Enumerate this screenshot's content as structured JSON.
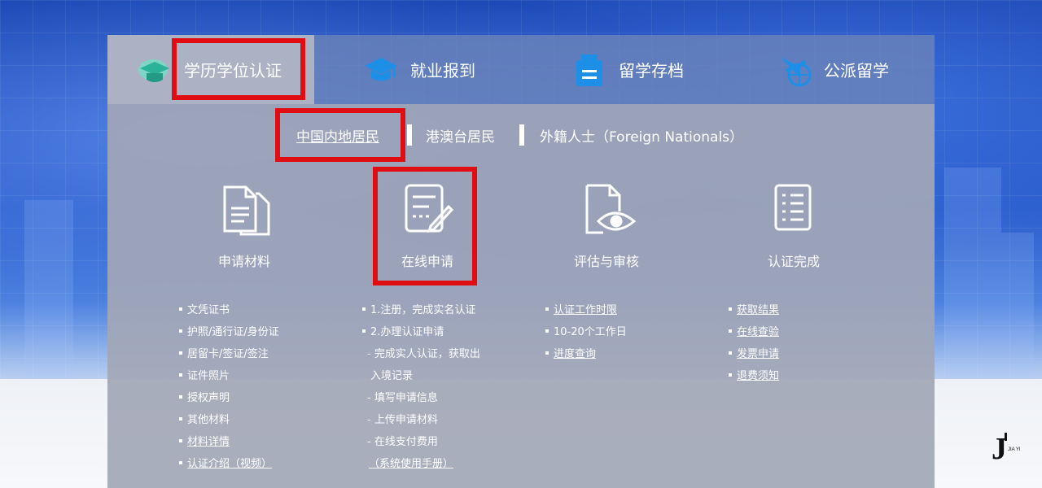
{
  "main_tabs": [
    {
      "label": "学历学位认证",
      "icon": "graduation-book-icon",
      "active": true
    },
    {
      "label": "就业报到",
      "icon": "mortarboard-icon"
    },
    {
      "label": "留学存档",
      "icon": "archive-card-icon"
    },
    {
      "label": "公派留学",
      "icon": "airplane-globe-icon"
    }
  ],
  "sub_tabs": [
    {
      "label": "中国内地居民",
      "active": true
    },
    {
      "label": "港澳台居民"
    },
    {
      "label": "外籍人士（Foreign Nationals）"
    }
  ],
  "steps": [
    {
      "label": "申请材料",
      "icon": "documents-icon"
    },
    {
      "label": "在线申请",
      "icon": "edit-form-icon"
    },
    {
      "label": "评估与审核",
      "icon": "document-eye-icon"
    },
    {
      "label": "认证完成",
      "icon": "checklist-icon"
    }
  ],
  "columns": [
    [
      {
        "text": "文凭证书",
        "bullet": true
      },
      {
        "text": "护照/通行证/身份证",
        "bullet": true
      },
      {
        "text": "居留卡/签证/签注",
        "bullet": true
      },
      {
        "text": "证件照片",
        "bullet": true
      },
      {
        "text": "授权声明",
        "bullet": true
      },
      {
        "text": "其他材料",
        "bullet": true
      },
      {
        "text": "材料详情",
        "bullet": true,
        "link": true
      },
      {
        "text": "认证介绍（视频）",
        "bullet": true,
        "link": true
      }
    ],
    [
      {
        "text": "1.注册，完成实名认证",
        "bullet": true
      },
      {
        "text": "2.办理认证申请",
        "bullet": true
      },
      {
        "text": " - 完成实人认证，获取出"
      },
      {
        "text": "入境记录"
      },
      {
        "text": " - 填写申请信息"
      },
      {
        "text": " - 上传申请材料"
      },
      {
        "text": " - 在线支付费用"
      },
      {
        "text": "（系统使用手册）",
        "link": true
      }
    ],
    [
      {
        "text": "认证工作时限",
        "bullet": true,
        "link": true
      },
      {
        "text": "10-20个工作日",
        "bullet": true
      },
      {
        "text": "进度查询",
        "bullet": true,
        "link": true
      }
    ],
    [
      {
        "text": "获取结果",
        "bullet": true,
        "link": true
      },
      {
        "text": "在线查验",
        "bullet": true,
        "link": true
      },
      {
        "text": "发票申请",
        "bullet": true,
        "link": true
      },
      {
        "text": "退费须知",
        "bullet": true,
        "link": true
      }
    ]
  ],
  "logo": {
    "mark": "J",
    "sub": "JIA YI"
  },
  "colors": {
    "highlight_red": "#e00d12",
    "tab_icon_blue": "#1e8fe6"
  }
}
